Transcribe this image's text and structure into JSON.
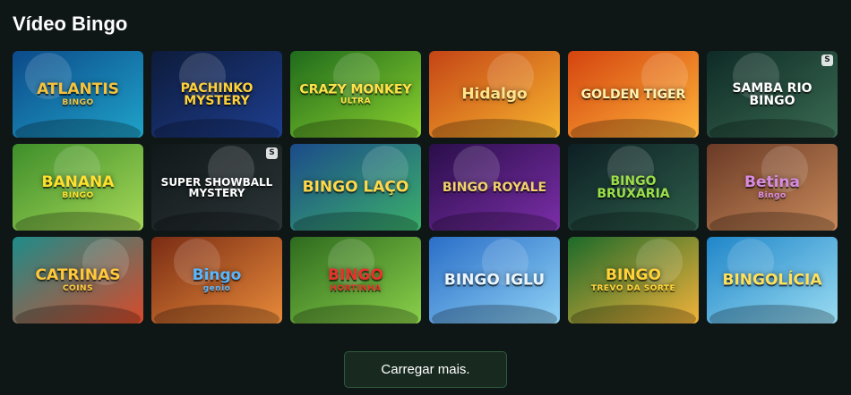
{
  "section": {
    "title": "Vídeo Bingo"
  },
  "games": [
    {
      "title": "ATLANTIS",
      "subtitle": "BINGO",
      "bg1": "#0c4a8a",
      "bg2": "#1fa3c9",
      "text_color": "#f7c23a",
      "badge": ""
    },
    {
      "title": "PACHINKO MYSTERY",
      "subtitle": "",
      "bg1": "#0d1b3a",
      "bg2": "#1e3e8f",
      "text_color": "#ffd23a",
      "badge": ""
    },
    {
      "title": "CRAZY MONKEY",
      "subtitle": "ULTRA",
      "bg1": "#1f6b1c",
      "bg2": "#8bd12e",
      "text_color": "#ffe14a",
      "badge": ""
    },
    {
      "title": "Hidalgo",
      "subtitle": "",
      "bg1": "#c44416",
      "bg2": "#f7b52e",
      "text_color": "#ffe38a",
      "badge": ""
    },
    {
      "title": "GOLDEN TIGER",
      "subtitle": "",
      "bg1": "#d4440f",
      "bg2": "#ffb43a",
      "text_color": "#fff3b0",
      "badge": ""
    },
    {
      "title": "SAMBA RIO BINGO",
      "subtitle": "",
      "bg1": "#0e2a26",
      "bg2": "#3a6b52",
      "text_color": "#ffffff",
      "badge": "S"
    },
    {
      "title": "BANANA",
      "subtitle": "BINGO",
      "bg1": "#3e8e2b",
      "bg2": "#a6d857",
      "text_color": "#ffe02e",
      "badge": ""
    },
    {
      "title": "SUPER SHOWBALL MYSTERY",
      "subtitle": "",
      "bg1": "#11181a",
      "bg2": "#2b3436",
      "text_color": "#ffffff",
      "badge": "S"
    },
    {
      "title": "BINGO LAÇO",
      "subtitle": "",
      "bg1": "#1b4b8a",
      "bg2": "#3bb06a",
      "text_color": "#ffd84a",
      "badge": ""
    },
    {
      "title": "BINGO ROYALE",
      "subtitle": "",
      "bg1": "#2a0e4a",
      "bg2": "#7b2ea8",
      "text_color": "#f2d06b",
      "badge": ""
    },
    {
      "title": "BINGO BRUXARIA",
      "subtitle": "",
      "bg1": "#0d1f24",
      "bg2": "#2e5e4a",
      "text_color": "#9be04a",
      "badge": ""
    },
    {
      "title": "Betina",
      "subtitle": "Bingo",
      "bg1": "#6a3a26",
      "bg2": "#c98a5a",
      "text_color": "#d98be0",
      "badge": ""
    },
    {
      "title": "CATRINAS",
      "subtitle": "COINS",
      "bg1": "#1e8c8a",
      "bg2": "#d84a2a",
      "text_color": "#ffc93a",
      "badge": ""
    },
    {
      "title": "Bingo",
      "subtitle": "genio",
      "bg1": "#7a2c14",
      "bg2": "#e88a3a",
      "text_color": "#58b7ff",
      "badge": ""
    },
    {
      "title": "BINGO",
      "subtitle": "HORTINHA",
      "bg1": "#2e6a1e",
      "bg2": "#8ad04a",
      "text_color": "#e8322a",
      "badge": ""
    },
    {
      "title": "BINGO IGLU",
      "subtitle": "",
      "bg1": "#2a6ec8",
      "bg2": "#8fd2f5",
      "text_color": "#eaf6ff",
      "badge": ""
    },
    {
      "title": "BINGO",
      "subtitle": "TREVO DA SORTE",
      "bg1": "#1c6a2a",
      "bg2": "#f2b23a",
      "text_color": "#ffd23a",
      "badge": ""
    },
    {
      "title": "BINGOLÍCIA",
      "subtitle": "",
      "bg1": "#1f86c9",
      "bg2": "#9adcf2",
      "text_color": "#ffe05a",
      "badge": ""
    }
  ],
  "actions": {
    "load_more": "Carregar mais."
  }
}
